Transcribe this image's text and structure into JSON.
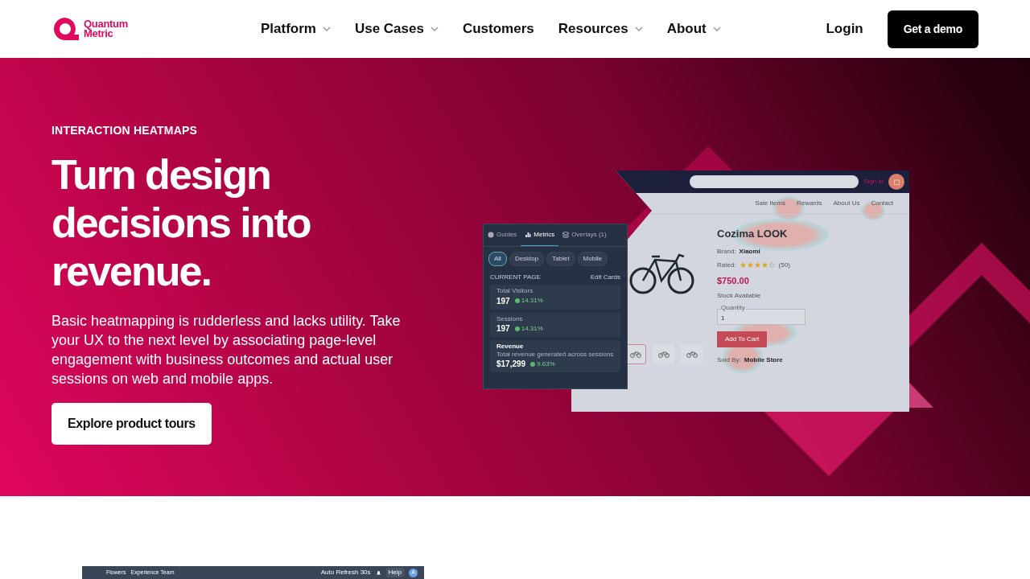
{
  "header": {
    "logo_text": [
      "Quantum",
      "Metric"
    ],
    "nav": [
      {
        "label": "Platform",
        "dropdown": true
      },
      {
        "label": "Use Cases",
        "dropdown": true
      },
      {
        "label": "Customers",
        "dropdown": false
      },
      {
        "label": "Resources",
        "dropdown": true
      },
      {
        "label": "About",
        "dropdown": true
      }
    ],
    "login": "Login",
    "cta": "Get a demo"
  },
  "hero": {
    "eyebrow": "INTERACTION HEATMAPS",
    "title": "Turn design decisions into revenue.",
    "description": "Basic heatmapping is rudderless and lacks utility. Take your UX to the next level by associating page-level engagement with business outcomes and actual user sessions on web and mobile apps.",
    "button": "Explore product tours",
    "store": {
      "sign_in": "Sign In",
      "nav": [
        "Sale Items",
        "Rewards",
        "About Us",
        "Contact"
      ],
      "product": "Cozima LOOK",
      "brand_label": "Brand:",
      "brand": "Xiaomi",
      "rated_label": "Rated:",
      "stars": 4,
      "reviews": "(50)",
      "price": "$750.00",
      "stock": "Stock Available",
      "quantity_label": "Quantity",
      "quantity": "1",
      "add_button": "Add To Cart",
      "thumbnails": [
        {
          "selected": true
        },
        {
          "selected": false
        },
        {
          "selected": false
        }
      ],
      "sold_by_label": "Sold By:",
      "sold_by": "Mobile Store"
    },
    "panel": {
      "tabs": [
        {
          "label": "Guides",
          "selected": false
        },
        {
          "label": "Metrics",
          "selected": true
        },
        {
          "label": "Overlays (1)",
          "selected": false
        }
      ],
      "filters": [
        {
          "label": "All",
          "selected": true
        },
        {
          "label": "Desktop",
          "selected": false
        },
        {
          "label": "Tablet",
          "selected": false
        },
        {
          "label": "Mobile",
          "selected": false
        }
      ],
      "section": "CURRENT PAGE",
      "edit": "Edit Cards",
      "cards": [
        {
          "title": "Total Visitors",
          "value": "197",
          "change": "14.31%"
        },
        {
          "title": "Sessions",
          "value": "197",
          "change": "14.31%"
        },
        {
          "title": "Revenue",
          "subtitle": "Total revenue generated across sessions",
          "value": "$17,299",
          "change": "9.63%"
        }
      ]
    }
  },
  "app_bar": {
    "workspace": "Flowers",
    "team": "Experience Team",
    "refresh_label": "Auto Refresh",
    "refresh_value": "30s",
    "help": "Help",
    "avatar": "A"
  }
}
